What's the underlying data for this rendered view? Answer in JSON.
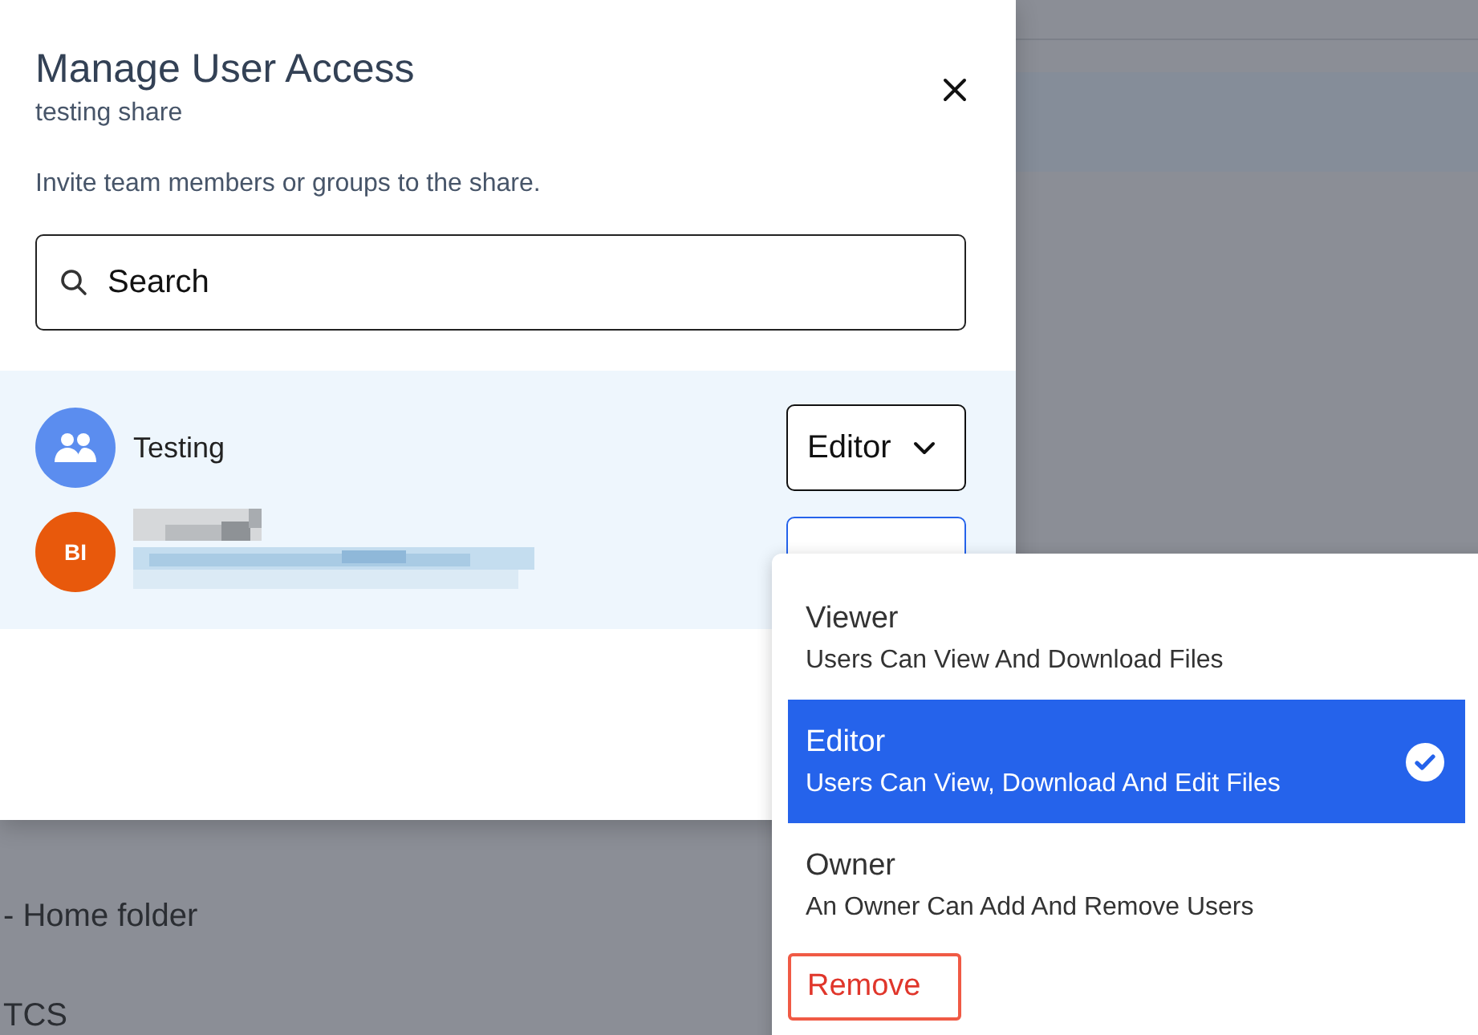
{
  "background": {
    "rows": [
      "- Home folder",
      "TCS"
    ]
  },
  "dialog": {
    "title": "Manage User Access",
    "subtitle": "testing share",
    "instructions": "Invite team members or groups to the share.",
    "search": {
      "placeholder": "Search"
    },
    "members": [
      {
        "kind": "group",
        "name": "Testing",
        "role": "Editor",
        "menu_open": false
      },
      {
        "kind": "user",
        "initials": "BI",
        "name_redacted": true,
        "menu_open": true
      }
    ]
  },
  "role_menu": {
    "options": [
      {
        "label": "Viewer",
        "description": "Users Can View And Download Files",
        "selected": false
      },
      {
        "label": "Editor",
        "description": "Users Can View, Download And Edit Files",
        "selected": true
      },
      {
        "label": "Owner",
        "description": "An Owner Can Add And Remove Users",
        "selected": false
      }
    ],
    "remove": "Remove"
  }
}
